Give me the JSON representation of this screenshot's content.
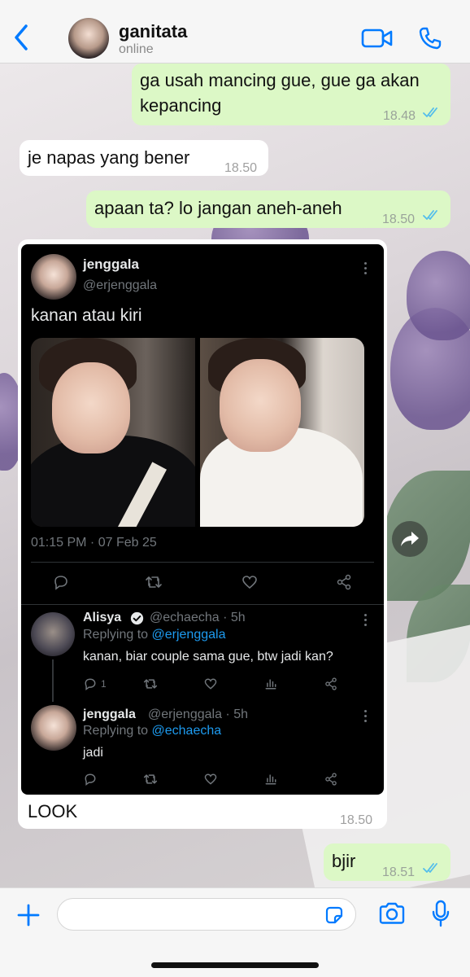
{
  "header": {
    "contact_name": "ganitata",
    "status": "online"
  },
  "messages": [
    {
      "direction": "outgoing",
      "text_line1": "ga usah mancing gue, gue ga akan",
      "text_line2": "kepancing",
      "time": "18.48",
      "read": true
    },
    {
      "direction": "incoming",
      "text": "je napas yang bener",
      "time": "18.50"
    },
    {
      "direction": "outgoing",
      "text": "apaan ta? lo jangan aneh-aneh",
      "time": "18.50",
      "read": true
    },
    {
      "direction": "incoming",
      "text": "LOOK",
      "time": "18.50"
    },
    {
      "direction": "outgoing",
      "text": "bjir",
      "time": "18.51",
      "read": true
    }
  ],
  "tweet": {
    "author_name": "jenggala",
    "author_handle": "@erjenggala",
    "text": "kanan atau kiri",
    "timestamp": "01:15 PM · 07 Feb 25",
    "replies": [
      {
        "name": "Alisya",
        "handle_time": "@echaecha · 5h",
        "replying_prefix": "Replying to ",
        "replying_to": "@erjenggala",
        "text": "kanan, biar couple sama gue, btw jadi kan?",
        "reply_count": "1"
      },
      {
        "name": "jenggala",
        "handle_time": "@erjenggala · 5h",
        "replying_prefix": "Replying to ",
        "replying_to": "@echaecha",
        "text": "jadi"
      }
    ]
  },
  "composer": {
    "value": ""
  },
  "colors": {
    "accent": "#007aff",
    "outgoing_bubble": "#dcf8c6",
    "incoming_bubble": "#ffffff",
    "tweet_bg": "#000000",
    "tweet_link": "#1d9bf0",
    "read_tick": "#53bdeb"
  }
}
